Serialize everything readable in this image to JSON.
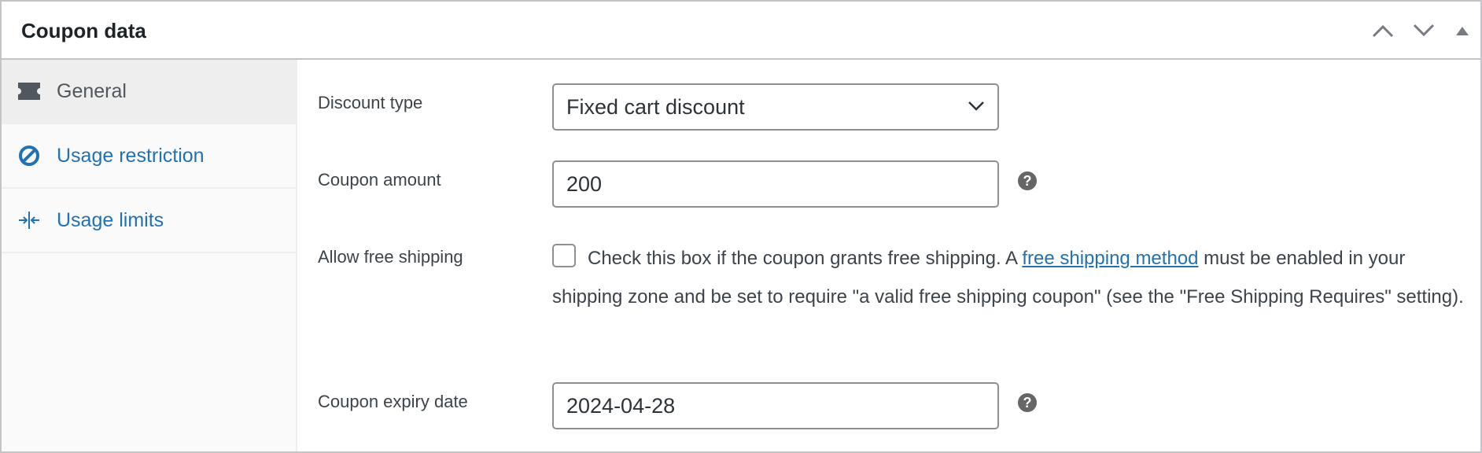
{
  "header": {
    "title": "Coupon data",
    "actions": [
      {
        "name": "move-up",
        "icon": "chevron-up-icon"
      },
      {
        "name": "move-down",
        "icon": "chevron-down-icon"
      },
      {
        "name": "toggle-panel",
        "icon": "triangle-up-icon"
      }
    ]
  },
  "sidebar": {
    "tabs": [
      {
        "label": "General",
        "icon": "ticket-icon",
        "active": true
      },
      {
        "label": "Usage restriction",
        "icon": "prohibited-icon",
        "active": false
      },
      {
        "label": "Usage limits",
        "icon": "collapse-arrows-icon",
        "active": false
      }
    ]
  },
  "fields": {
    "discount_type": {
      "label": "Discount type",
      "value": "Fixed cart discount"
    },
    "coupon_amount": {
      "label": "Coupon amount",
      "value": "200",
      "help": "?"
    },
    "free_shipping": {
      "label": "Allow free shipping",
      "checked": false,
      "text_before": "Check this box if the coupon grants free shipping. A ",
      "link_text": "free shipping method",
      "text_after": " must be enabled in your shipping zone and be set to require \"a valid free shipping coupon\" (see the \"Free Shipping Requires\" setting)."
    },
    "expiry_date": {
      "label": "Coupon expiry date",
      "value": "2024-04-28",
      "help": "?"
    }
  },
  "colors": {
    "link": "#2271b1",
    "border": "#c3c4c7",
    "active_tab_bg": "#eeeeee",
    "sidebar_bg": "#fafafa"
  }
}
